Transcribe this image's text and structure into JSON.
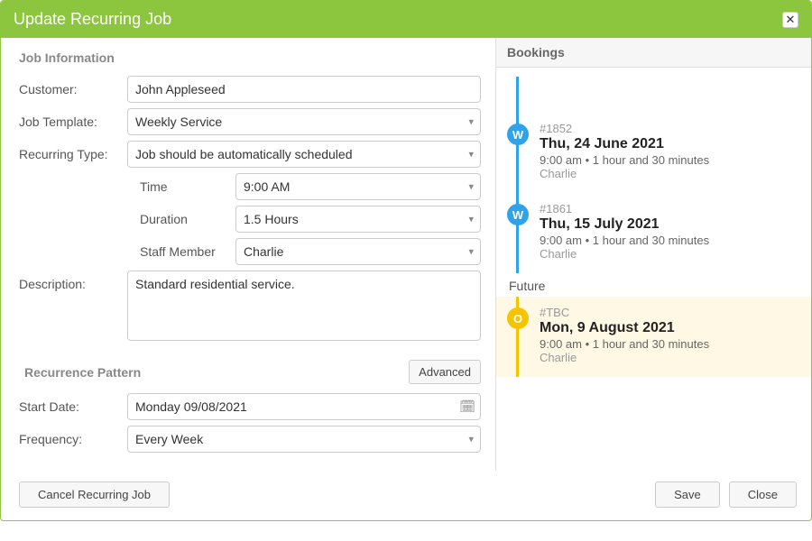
{
  "dialog": {
    "title": "Update Recurring Job",
    "close_glyph": "✕"
  },
  "job_info": {
    "header": "Job Information",
    "customer_label": "Customer:",
    "customer_value": "John Appleseed",
    "template_label": "Job Template:",
    "template_value": "Weekly Service",
    "recurring_label": "Recurring Type:",
    "recurring_value": "Job should be automatically scheduled",
    "time_label": "Time",
    "time_value": "9:00 AM",
    "duration_label": "Duration",
    "duration_value": "1.5 Hours",
    "staff_label": "Staff Member",
    "staff_value": "Charlie",
    "description_label": "Description:",
    "description_value": "Standard residential service."
  },
  "recurrence": {
    "header": "Recurrence Pattern",
    "advanced_label": "Advanced",
    "start_label": "Start Date:",
    "start_value": "Monday 09/08/2021",
    "frequency_label": "Frequency:",
    "frequency_value": "Every Week"
  },
  "footer": {
    "cancel_job_label": "Cancel Recurring Job",
    "save_label": "Save",
    "close_label": "Close"
  },
  "bookings": {
    "header": "Bookings",
    "future_label": "Future",
    "items": [
      {
        "badge": "W",
        "color": "blue",
        "jobno": "#1852",
        "date": "Thu, 24 June 2021",
        "details": "9:00 am • 1 hour and 30 minutes",
        "staff": "Charlie"
      },
      {
        "badge": "W",
        "color": "blue",
        "jobno": "#1861",
        "date": "Thu, 15 July 2021",
        "details": "9:00 am • 1 hour and 30 minutes",
        "staff": "Charlie"
      }
    ],
    "future": [
      {
        "badge": "O",
        "color": "yellow",
        "jobno": "#TBC",
        "date": "Mon, 9 August 2021",
        "details": "9:00 am • 1 hour and 30 minutes",
        "staff": "Charlie"
      }
    ]
  },
  "icons": {
    "chevron": "▾",
    "calendar": "🗓"
  }
}
